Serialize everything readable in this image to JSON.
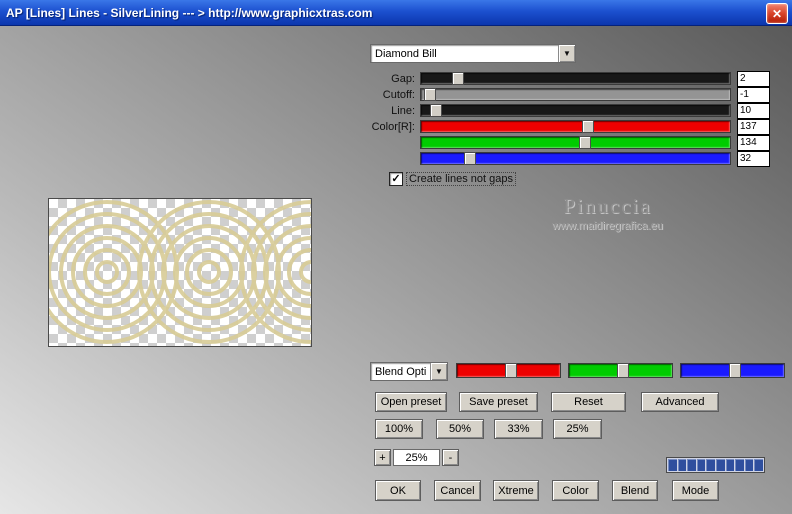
{
  "window": {
    "title": "AP [Lines]  Lines - SilverLining    --- > http://www.graphicxtras.com"
  },
  "icons": {
    "close": "✕",
    "chevron_down": "▼",
    "check": "✓"
  },
  "preset": {
    "value": "Diamond Bill"
  },
  "sliders": {
    "rows": [
      {
        "label": "Gap:",
        "value": "2"
      },
      {
        "label": "Cutoff:",
        "value": "-1"
      },
      {
        "label": "Line:",
        "value": "10"
      },
      {
        "label": "Color[R]:",
        "value": "137"
      },
      {
        "label": "",
        "value": "134"
      },
      {
        "label": "",
        "value": "32"
      }
    ]
  },
  "options": {
    "create_lines_label": "Create lines not gaps",
    "checked": true
  },
  "watermark": {
    "name": "Pinuccia",
    "site": "www.maidiregrafica.eu"
  },
  "blend": {
    "dropdown_value": "Blend Opti"
  },
  "buttons": {
    "open_preset": "Open preset",
    "save_preset": "Save preset",
    "reset": "Reset",
    "advanced": "Advanced",
    "zoom_100": "100%",
    "zoom_50": "50%",
    "zoom_33": "33%",
    "zoom_25": "25%",
    "plus": "+",
    "minus": "-",
    "ok": "OK",
    "cancel": "Cancel",
    "xtreme": "Xtreme",
    "color": "Color",
    "blend": "Blend",
    "mode": "Mode"
  },
  "zoom": {
    "level": "25%"
  },
  "colors": {
    "title_blue": "#1c50cf",
    "slider_red": "#ee0000",
    "slider_green": "#00cc00",
    "slider_blue": "#1a1aff",
    "progress_blue": "#2f4f9e",
    "preview_ring": "#d8cc96"
  }
}
